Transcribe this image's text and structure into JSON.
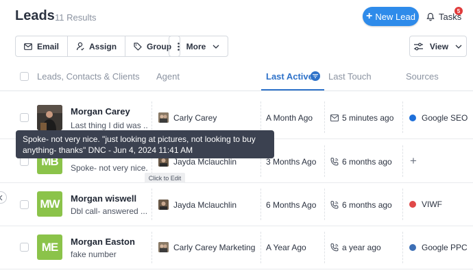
{
  "header": {
    "title": "Leads",
    "result_count": "11 Results",
    "new_lead_label": "New Lead",
    "tasks_label": "Tasks",
    "tasks_badge": "5"
  },
  "toolbar": {
    "email_label": "Email",
    "assign_label": "Assign",
    "group_label": "Group",
    "more_label": "More",
    "view_label": "View"
  },
  "columns": {
    "leads": "Leads, Contacts & Clients",
    "agent": "Agent",
    "last_active": "Last Active",
    "last_touch": "Last Touch",
    "sources": "Sources"
  },
  "rows": [
    {
      "name": "Morgan Carey",
      "note": "Last thing I did was ...",
      "agent": "Carly Carey",
      "last_active": "A Month Ago",
      "touch_icon": "envelope-icon",
      "last_touch": "5 minutes ago",
      "source": "Google SEO",
      "source_color": "#1e6fd9"
    },
    {
      "name": "",
      "initials": "MB",
      "note": "Spoke- not very nice...",
      "agent": "Jayda Mclauchlin",
      "last_active": "3 Months Ago",
      "touch_icon": "phone-icon",
      "last_touch": "6 months ago",
      "source": "+",
      "source_color": ""
    },
    {
      "name": "Morgan wiswell",
      "initials": "MW",
      "note": "Dbl call- answered ...",
      "agent": "Jayda Mclauchlin",
      "last_active": "6 Months Ago",
      "touch_icon": "phone-icon",
      "last_touch": "6 months ago",
      "source": "VIWF",
      "source_color": "#e04848"
    },
    {
      "name": "Morgan Easton",
      "initials": "ME",
      "note": "fake number",
      "agent": "Carly Carey Marketing",
      "last_active": "A Year Ago",
      "touch_icon": "phone-icon",
      "last_touch": "a year ago",
      "source": "Google PPC",
      "source_color": "#3d6fb5"
    }
  ],
  "tooltip": {
    "text": "Spoke- not very nice. \"just looking at pictures, not looking to buy anything- thanks\" DNC - Jun 4, 2024 11:41 AM"
  },
  "edit_hint": "Click to Edit",
  "colors": {
    "accent": "#2e8bea",
    "active_column": "#2e72c9",
    "avatar_green": "#8bc34a",
    "badge_red": "#e03b3b"
  }
}
